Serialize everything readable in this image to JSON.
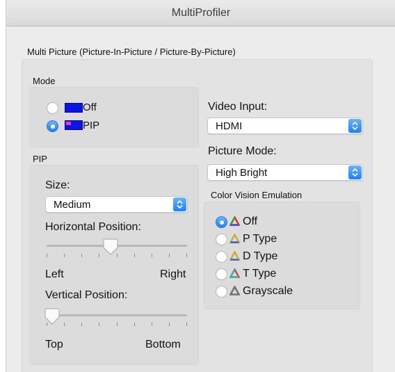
{
  "window": {
    "title": "MultiProfiler"
  },
  "multi_picture": {
    "label": "Multi Picture (Picture-In-Picture / Picture-By-Picture)",
    "mode": {
      "label": "Mode",
      "options": [
        {
          "label": "Off",
          "selected": false
        },
        {
          "label": "PIP",
          "selected": true
        }
      ]
    },
    "pip": {
      "label": "PIP",
      "size": {
        "label": "Size:",
        "value": "Medium"
      },
      "horizontal": {
        "label": "Horizontal Position:",
        "min_label": "Left",
        "max_label": "Right",
        "value_fraction": 0.45
      },
      "vertical": {
        "label": "Vertical Position:",
        "min_label": "Top",
        "max_label": "Bottom",
        "value_fraction": 0.0
      }
    },
    "video_input": {
      "label": "Video Input:",
      "value": "HDMI"
    },
    "picture_mode": {
      "label": "Picture Mode:",
      "value": "High Bright"
    },
    "color_vision": {
      "label": "Color Vision Emulation",
      "options": [
        {
          "label": "Off",
          "selected": true,
          "icon": "color-triangle-full-icon"
        },
        {
          "label": "P Type",
          "selected": false,
          "icon": "color-triangle-p-icon"
        },
        {
          "label": "D Type",
          "selected": false,
          "icon": "color-triangle-d-icon"
        },
        {
          "label": "T Type",
          "selected": false,
          "icon": "color-triangle-t-icon"
        },
        {
          "label": "Grayscale",
          "selected": false,
          "icon": "color-triangle-gray-icon"
        }
      ]
    }
  },
  "colors": {
    "accent": "#1a82fb",
    "swatch_blue": "#0a14e6",
    "swatch_pip": "#e83ad6"
  }
}
